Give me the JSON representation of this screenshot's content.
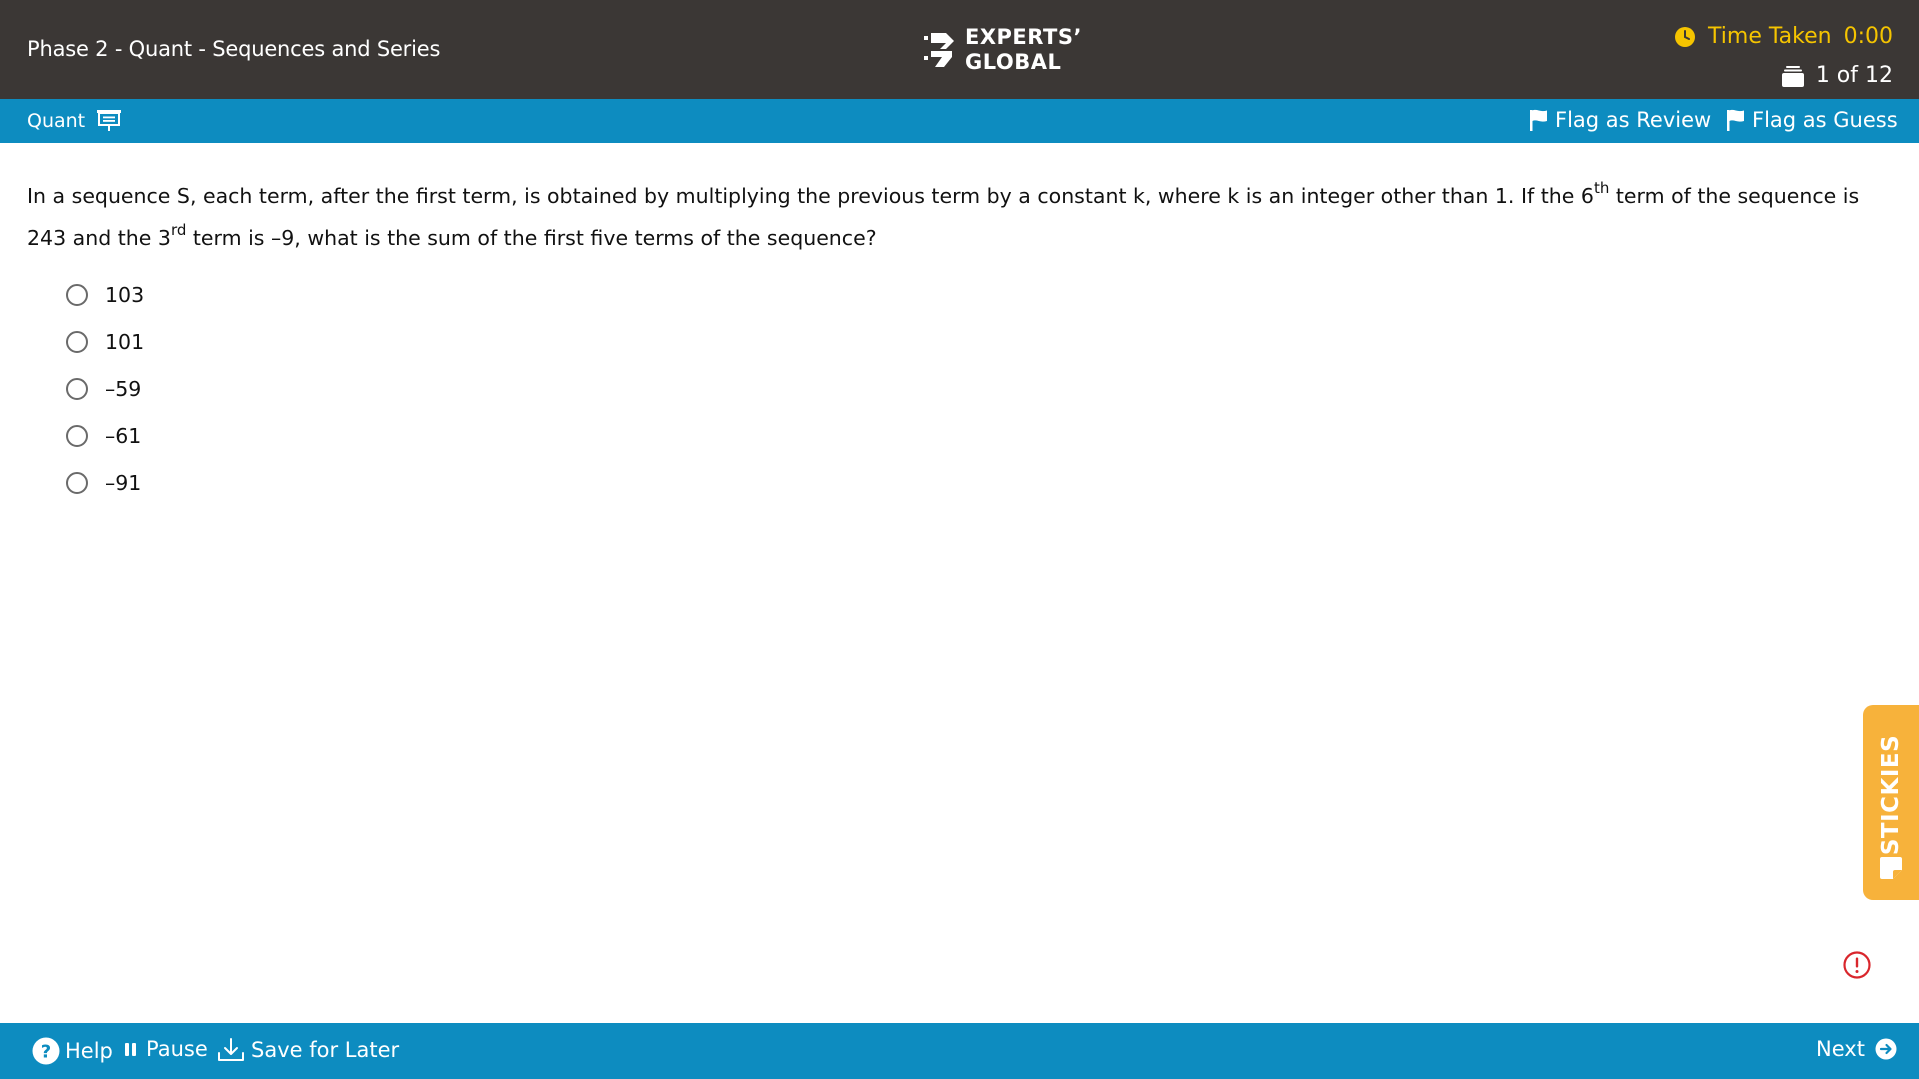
{
  "header": {
    "exam_title": "Phase 2 - Quant - Sequences and Series",
    "logo_line1": "EXPERTS’",
    "logo_line2": "GLOBAL",
    "timer_label": "Time Taken",
    "timer_value": "0:00",
    "question_counter": "1 of 12"
  },
  "subbar": {
    "section": "Quant",
    "flag_review": "Flag as Review",
    "flag_guess": "Flag as Guess"
  },
  "question": {
    "text_a": "In a sequence S, each term, after the first term, is obtained by multiplying the previous term by a constant k, where k is an integer other than 1. If the 6",
    "sup_a": "th",
    "text_b": " term of the sequence is 243 and the 3",
    "sup_b": "rd",
    "text_c": " term is –9, what is the sum of the first five terms of the sequence?",
    "options": [
      "103",
      "101",
      "–59",
      "–61",
      "–91"
    ]
  },
  "stickies_label": "STICKIES",
  "footer": {
    "help": "Help",
    "pause": "Pause",
    "save": "Save for Later",
    "next": "Next"
  },
  "colors": {
    "topbar": "#3b3735",
    "accent_blue": "#0d8cc0",
    "timer_yellow": "#f5c400",
    "stickies_orange": "#f7b23b",
    "alert_red": "#d9262c"
  }
}
